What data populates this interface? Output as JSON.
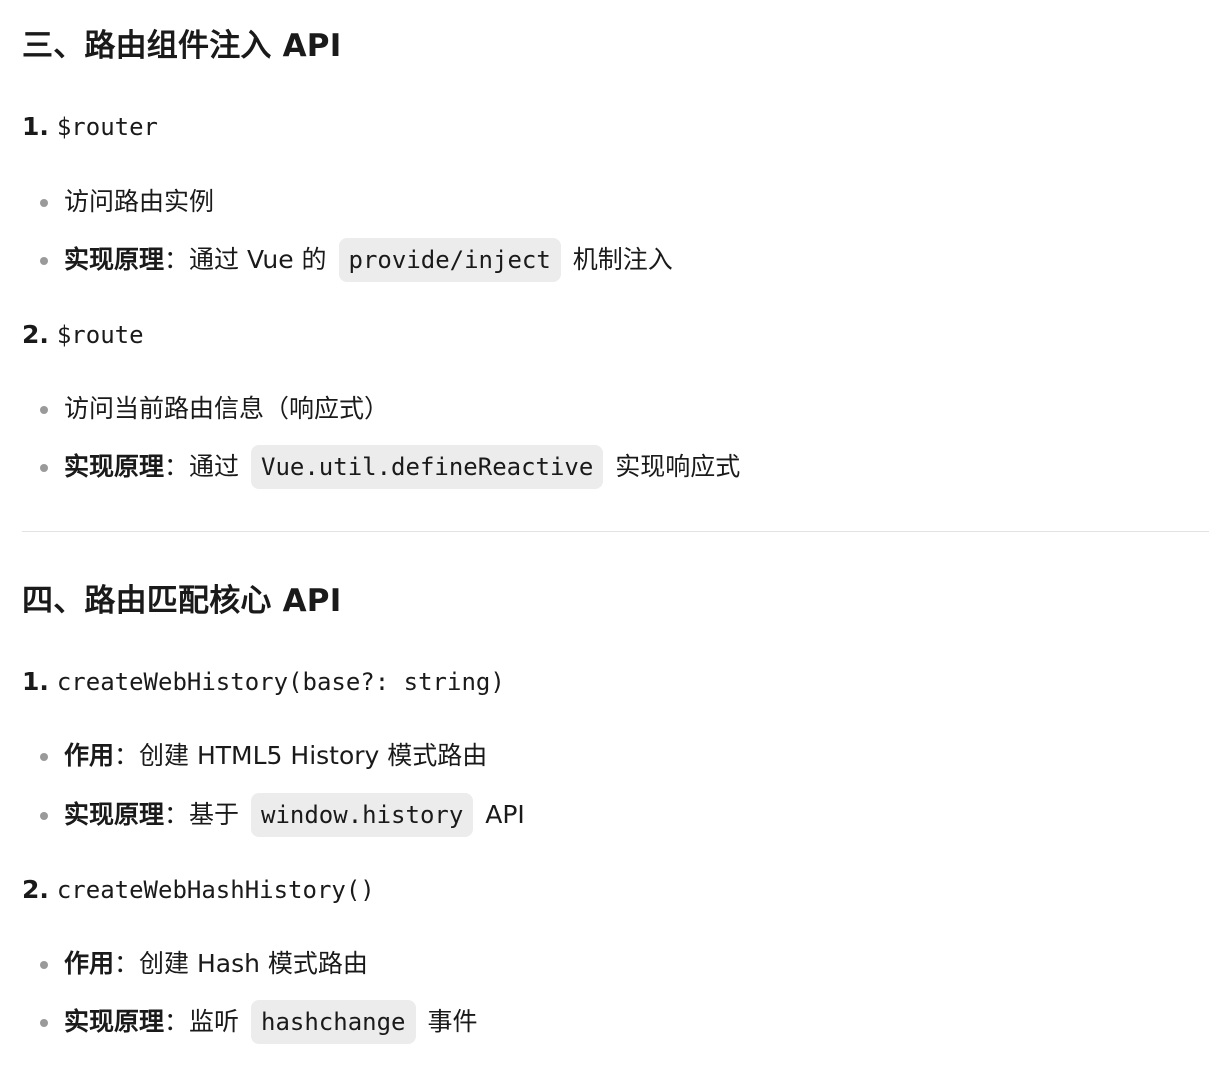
{
  "section3": {
    "title": "三、路由组件注入 API",
    "items": [
      {
        "num": "1.",
        "code": "$router",
        "bullets": [
          {
            "text": "访问路由实例"
          },
          {
            "bold": "实现原理",
            "colon": "：",
            "pre": "通过 Vue 的",
            "code": "provide/inject",
            "post": "机制注入"
          }
        ]
      },
      {
        "num": "2.",
        "code": "$route",
        "bullets": [
          {
            "text": "访问当前路由信息（响应式）"
          },
          {
            "bold": "实现原理",
            "colon": "：",
            "pre": "通过",
            "code": "Vue.util.defineReactive",
            "post": "实现响应式"
          }
        ]
      }
    ]
  },
  "section4": {
    "title": "四、路由匹配核心 API",
    "items": [
      {
        "num": "1.",
        "code": "createWebHistory(base?: string)",
        "bullets": [
          {
            "bold": "作用",
            "colon": "：",
            "text": "创建 HTML5 History 模式路由"
          },
          {
            "bold": "实现原理",
            "colon": "：",
            "pre": "基于",
            "code": "window.history",
            "post": "API"
          }
        ]
      },
      {
        "num": "2.",
        "code": "createWebHashHistory()",
        "bullets": [
          {
            "bold": "作用",
            "colon": "：",
            "text": "创建 Hash 模式路由"
          },
          {
            "bold": "实现原理",
            "colon": "：",
            "pre": "监听",
            "code": "hashchange",
            "post": "事件"
          }
        ]
      }
    ]
  }
}
